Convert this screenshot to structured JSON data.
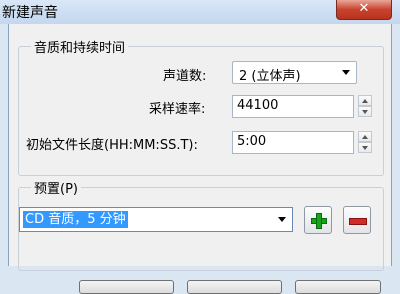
{
  "window": {
    "title": "新建声音",
    "close_glyph": "✕"
  },
  "quality_group": {
    "title": "音质和持续时间",
    "channels": {
      "label": "声道数:",
      "value": "2 (立体声)"
    },
    "sample_rate": {
      "label": "采样速率:",
      "value": "44100"
    },
    "length": {
      "label": "初始文件长度(HH:MM:SS.T):",
      "value": "5:00"
    }
  },
  "preset_group": {
    "title": "预置(P)",
    "selected": "CD 音质，5 分钟"
  },
  "icons": {
    "add": "plus-icon",
    "remove": "minus-icon",
    "add_color": "#17a31a",
    "remove_color": "#d42a2a"
  }
}
